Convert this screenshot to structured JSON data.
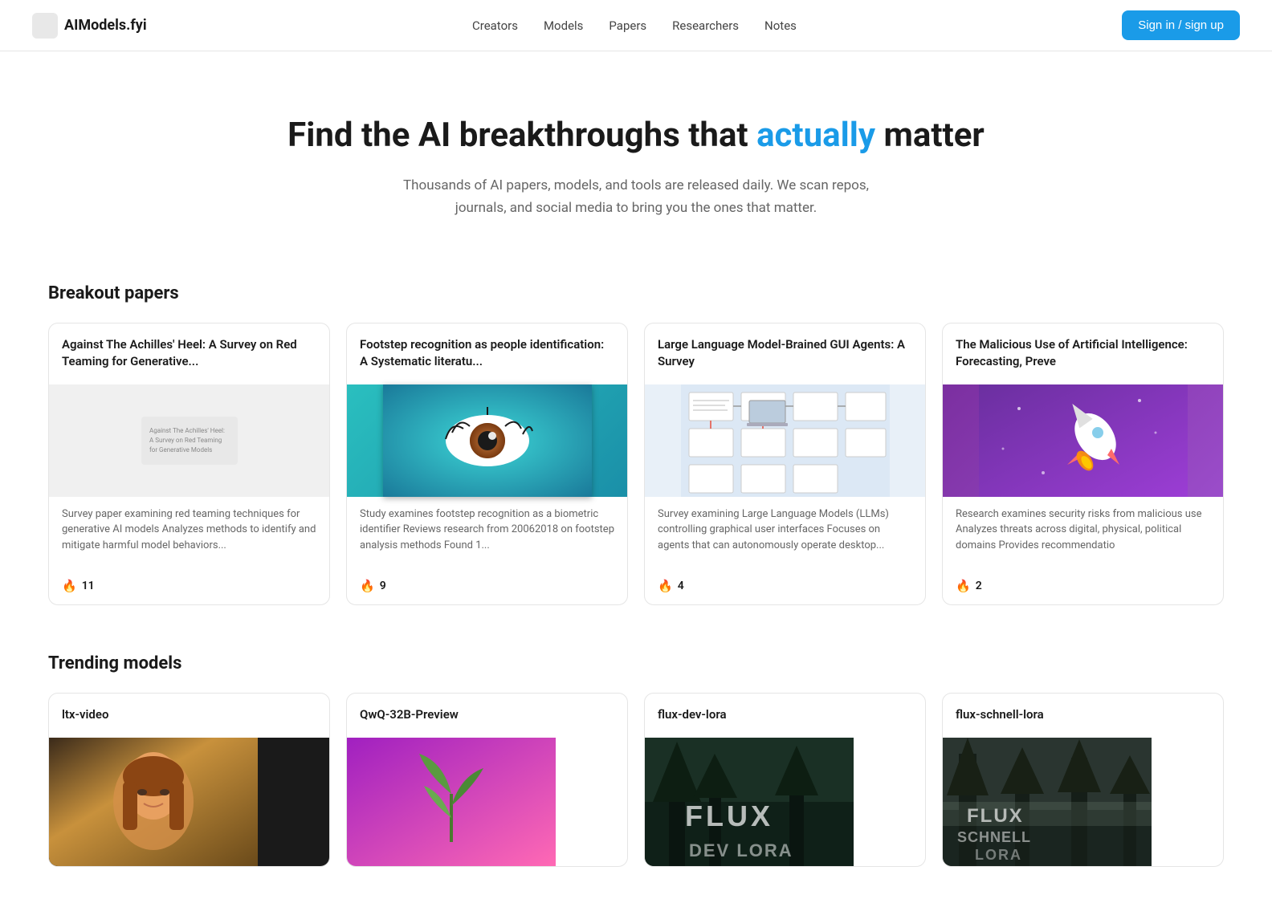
{
  "header": {
    "logo_text": "AIModels.fyi",
    "nav_items": [
      {
        "label": "Creators",
        "href": "#"
      },
      {
        "label": "Models",
        "href": "#"
      },
      {
        "label": "Papers",
        "href": "#"
      },
      {
        "label": "Researchers",
        "href": "#"
      },
      {
        "label": "Notes",
        "href": "#"
      }
    ],
    "sign_in_label": "Sign in / sign up"
  },
  "hero": {
    "title_prefix": "Find the AI breakthroughs that ",
    "title_accent": "actually",
    "title_suffix": " matter",
    "subtitle": "Thousands of AI papers, models, and tools are released daily. We scan repos, journals, and social media to bring you the ones that matter."
  },
  "breakout_papers": {
    "section_title": "Breakout papers",
    "cards": [
      {
        "title": "Against The Achilles' Heel: A Survey on Red Teaming for Generative...",
        "description": "Survey paper examining red teaming techniques for generative AI models Analyzes methods to identify and mitigate harmful model behaviors...",
        "fire_count": "11",
        "img_alt": "Against The Achilles' Heel: A Survey on Red Teaming for Generative Models",
        "img_type": "broken"
      },
      {
        "title": "Footstep recognition as people identification: A Systematic literatu...",
        "description": "Study examines footstep recognition as a biometric identifier Reviews research from 20062018 on footstep analysis methods Found 1...",
        "fire_count": "9",
        "img_type": "eye"
      },
      {
        "title": "Large Language Model-Brained GUI Agents: A Survey",
        "description": "Survey examining Large Language Models (LLMs) controlling graphical user interfaces Focuses on agents that can autonomously operate desktop...",
        "fire_count": "4",
        "img_type": "diagram"
      },
      {
        "title": "The Malicious Use of Artificial Intelligence: Forecasting, Preve",
        "description": "Research examines security risks from malicious use Analyzes threats across digital, physical, political domains Provides recommendatio",
        "fire_count": "2",
        "img_type": "rocket"
      }
    ]
  },
  "trending_models": {
    "section_title": "Trending models",
    "cards": [
      {
        "title": "ltx-video",
        "img_type": "person"
      },
      {
        "title": "QwQ-32B-Preview",
        "img_type": "leaf"
      },
      {
        "title": "flux-dev-lora",
        "img_type": "flux_dev"
      },
      {
        "title": "flux-schnell-lora",
        "img_type": "flux_schnell"
      }
    ]
  }
}
